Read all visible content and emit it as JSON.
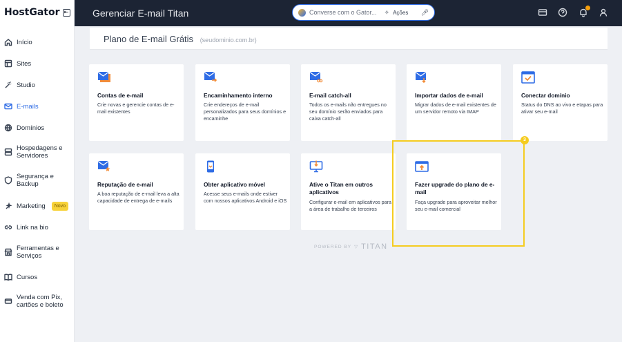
{
  "sidebar": {
    "logo": "HostGator",
    "items": [
      {
        "label": "Início"
      },
      {
        "label": "Sites"
      },
      {
        "label": "Studio"
      },
      {
        "label": "E-mails"
      },
      {
        "label": "Domínios"
      },
      {
        "label": "Hospedagens e Servidores"
      },
      {
        "label": "Segurança e Backup"
      },
      {
        "label": "Marketing",
        "badge": "Novo"
      },
      {
        "label": "Link na bio"
      },
      {
        "label": "Ferramentas e Serviços"
      },
      {
        "label": "Cursos"
      },
      {
        "label": "Venda com Pix, cartões e boleto"
      }
    ]
  },
  "header": {
    "title": "Gerenciar E-mail Titan",
    "assistant_placeholder": "Converse com o Gator...",
    "actions_label": "Ações"
  },
  "plan": {
    "title": "Plano de E-mail Grátis",
    "domain": "(seudominio.com.br)"
  },
  "cards": [
    {
      "title": "Contas de e-mail",
      "desc": "Crie novas e gerencie contas de e-mail existentes",
      "icon": "mail-stack-icon"
    },
    {
      "title": "Encaminhamento interno",
      "desc": "Crie endereços de e-mail personalizados para seus domínios e encaminhe",
      "icon": "mail-forward-icon"
    },
    {
      "title": "E-mail catch-all",
      "desc": "Todos os e-mails não entregues no seu domínio serão enviados para caixa catch-all",
      "icon": "mail-catchall-icon"
    },
    {
      "title": "Importar dados de e-mail",
      "desc": "Migrar dados de e-mail existentes de um servidor remoto via IMAP",
      "icon": "mail-import-icon"
    },
    {
      "title": "Conectar domínio",
      "desc": "Status do DNS ao vivo e etapas para ativar seu e-mail",
      "icon": "domain-check-icon"
    },
    {
      "title": "Reputação de e-mail",
      "desc": "A boa reputação de e-mail leva a alta capacidade de entrega de e-mails",
      "icon": "mail-star-icon"
    },
    {
      "title": "Obter aplicativo móvel",
      "desc": "Acesse seus e-mails onde estiver com nossos aplicativos Android e iOS",
      "icon": "mobile-app-icon"
    },
    {
      "title": "Ative o Titan em outros aplicativos",
      "desc": "Configurar e-mail em aplicativos para a área de trabalho de terceiros",
      "icon": "desktop-app-icon"
    },
    {
      "title": "Fazer upgrade do plano de e-mail",
      "desc": "Faça upgrade para aproveitar melhor seu e-mail comercial",
      "icon": "upgrade-window-icon"
    }
  ],
  "step_badge": "3",
  "footer": {
    "powered_by": "POWERED BY",
    "brand": "TITAN"
  },
  "colors": {
    "accent": "#2f6ce5",
    "orange": "#f28c38",
    "highlight": "#f5cc1f",
    "header_bg": "#1c2434"
  }
}
